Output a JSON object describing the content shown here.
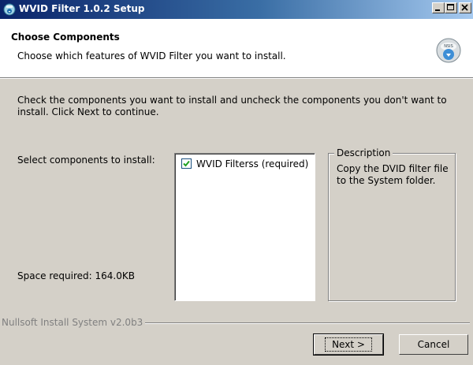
{
  "window": {
    "title": "WVID Filter 1.0.2 Setup"
  },
  "header": {
    "title": "Choose Components",
    "subtitle": "Choose which features of WVID Filter you want to install.",
    "icon": "installer-disc-icon"
  },
  "body": {
    "intro": "Check the components you want to install and uncheck the components you don't want to install. Click Next to continue.",
    "select_label": "Select components to install:",
    "space_required": "Space required: 164.0KB"
  },
  "components": [
    {
      "label": "WVID Filterss (required)",
      "checked": true
    }
  ],
  "description": {
    "legend": "Description",
    "text": "Copy the DVID filter file to the System folder."
  },
  "footer": {
    "branding": "Nullsoft Install System v2.0b3",
    "next_label": "Next >",
    "cancel_label": "Cancel"
  },
  "colors": {
    "dialog_bg": "#d4d0c8",
    "titlebar_start": "#0a246a",
    "titlebar_end": "#a6caf0",
    "check_color": "#21a121"
  }
}
